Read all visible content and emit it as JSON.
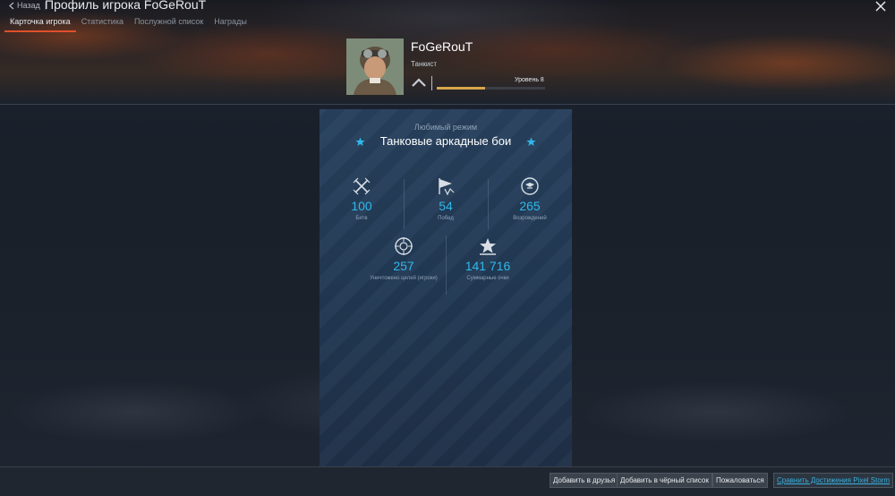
{
  "header": {
    "back_label": "Назад",
    "title": "Профиль игрока FoGeRouT",
    "tabs": [
      {
        "label": "Карточка игрока",
        "active": true
      },
      {
        "label": "Статистика",
        "active": false
      },
      {
        "label": "Послужной список",
        "active": false
      },
      {
        "label": "Награды",
        "active": false
      }
    ]
  },
  "profile": {
    "name": "FoGeRouT",
    "title": "Танкист",
    "level_label": "Уровень 8",
    "level_progress": 0.45
  },
  "card": {
    "favorite_label": "Любимый режим",
    "favorite_mode": "Танковые аркадные бои",
    "stats": [
      {
        "icon": "crossed-swords-icon",
        "value": "100",
        "label": "Битв"
      },
      {
        "icon": "victory-flag-icon",
        "value": "54",
        "label": "Побед"
      },
      {
        "icon": "respawn-icon",
        "value": "265",
        "label": "Возрождений"
      },
      {
        "icon": "target-icon",
        "value": "257",
        "label": "Уничтожено целей (игроки)"
      },
      {
        "icon": "score-star-icon",
        "value": "141 716",
        "label": "Суммарные очки"
      }
    ]
  },
  "footer": {
    "add_friend": "Добавить в друзья",
    "add_blacklist": "Добавить в чёрный список",
    "report": "Пожаловаться",
    "compare": "Сравнить Достижения Pixel Storm"
  },
  "colors": {
    "accent_tab": "#e0502a",
    "stat_value": "#2fb8ea",
    "level_fill": "#d8a64a",
    "star": "#2fb8ea"
  }
}
